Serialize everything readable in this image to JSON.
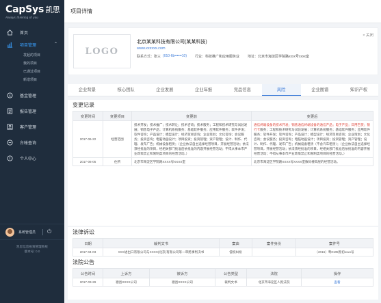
{
  "sidebar": {
    "brand": "CapSys",
    "brand_cn": "凯思",
    "slogan": "Always thinking of you",
    "home": "首页",
    "project_mgmt": "项目管理",
    "sub_items": [
      "发起的项目",
      "我的项目",
      "已通过项目",
      "新增项目"
    ],
    "nav": [
      "基金管理",
      "报告管理",
      "客户管理",
      "台帐查询",
      "个人中心"
    ],
    "user_name": "系统管理员",
    "sys_info_1": "凯思信息投资管理系统",
    "sys_info_2": "版本号: 0.0"
  },
  "header": {
    "title": "项目详情"
  },
  "company": {
    "logo_text": "LOGO",
    "name": "北京某某科技有限公司(某某科技)",
    "url": "www.xxxxxx.com",
    "contact_label": "联系方式：",
    "contact_name": "张三",
    "contact_phone": "(010-6b••••••10)",
    "industry_label": "行业：",
    "industry": "科技推广和应用服务业",
    "address_label": "地址：",
    "address": "北京市海淀区学院路xxxx号xxxx室",
    "close_label": "× 关闭"
  },
  "tabs": [
    "企业背景",
    "核心团队",
    "企业发展",
    "企业年报",
    "竞品信息",
    "风险",
    "企业图谱",
    "知识产权"
  ],
  "active_tab": "风险",
  "changes": {
    "title": "变更记录",
    "headers": [
      "变更时间",
      "变更项目",
      "变更前",
      "变更后"
    ],
    "rows": [
      {
        "date": "2017-06-22",
        "item": "经营范围",
        "before": "技术开发；技术推广；技术转让；技术咨询；技术服务；工程和技术研究与试验发展；销售电子产品；计算机系统服务；基础软件服务；应用软件服务；软件开发；软件咨询；产品设计；模型设计；经济贸易咨询；企业策划；文化咨询；会议服务；投资咨询；电脑动画设计；项目投资；投资管理；资产管理；设计、制作、代理、发布广告；机械设备租赁；（企业依法自主选择经营项目，开展经营活动；依法须经批准的项目，经相关部门批准后依批准的内容开展经营活动；不得从事本市产业政策禁止和限制类项目的经营活动。）",
        "after_highlight": "通信终端设备的技术开发；销售通信终端设备的通信产品；电子产品；日用百货；银行卡",
        "after_rest": "服务；工程和技术研究与试验发展；计算机系统服务；基础软件服务；应用软件服务；软件开发；软件咨询；产品设计；模型设计；经济贸易咨询；企业策划；文化咨询；会议服务；投资咨询；电脑动画设计；项目投资；投资管理；资产管理；设计、制作、代理、发布广告；机械设备租赁（不含汽车租赁）；（企业依法自主选择经营项目，开展经营活动；依法须经批准的项目，经相关部门批准后依批准的内容开展经营活动；不得从事本市产业政策禁止和限制类项目的经营活动。）"
      },
      {
        "date": "2017-06-05",
        "item": "住所",
        "before": "北京市海淀区学院路XXXX号XXXX室",
        "after": "北京市海淀区学院路XXXX号XXXX室数码楼四层的经营活动。"
      }
    ]
  },
  "lawsuits": {
    "title": "法律诉讼",
    "headers": [
      "日期",
      "裁判文书",
      "案由",
      "案件身份",
      "案件号"
    ],
    "rows": [
      {
        "date": "2017-04-03",
        "doc": "XXX进出口有限公司与XXXX(北京)有限公司等一审民事判决书",
        "cause": "侵权纠纷",
        "role": "",
        "case_no": "（2016）粤0105民初xxxx号"
      }
    ]
  },
  "notices": {
    "title": "法院公告",
    "headers": [
      "公告时间",
      "上诉方",
      "被诉方",
      "公告类型",
      "法院",
      "操作"
    ],
    "rows": [
      {
        "date": "2017-03-29",
        "appellant": "德昌XXXX公司",
        "defendant": "德昌XXXX公司",
        "type": "裁判文书",
        "court": "北京市海淀区人民法院",
        "action": "查看"
      }
    ]
  },
  "colors": {
    "accent": "#3a7ad9",
    "sidebar_bg": "#1f2d3d",
    "highlight": "#e04a3f"
  }
}
